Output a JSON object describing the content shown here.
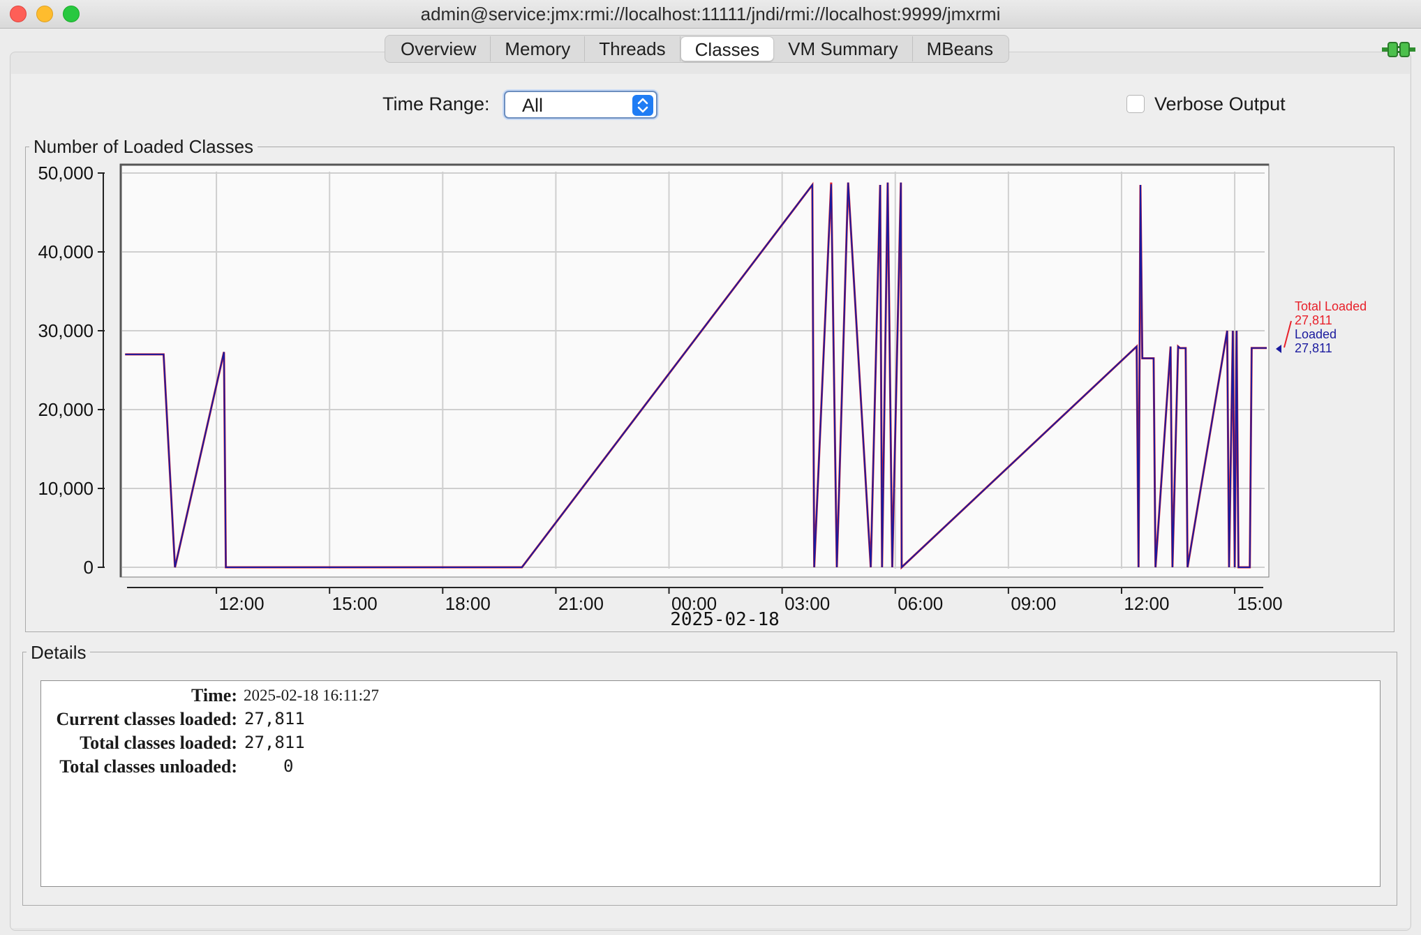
{
  "window": {
    "title": "admin@service:jmx:rmi://localhost:11111/jndi/rmi://localhost:9999/jmxrmi"
  },
  "tabs": [
    {
      "label": "Overview"
    },
    {
      "label": "Memory"
    },
    {
      "label": "Threads"
    },
    {
      "label": "Classes",
      "active": true
    },
    {
      "label": "VM Summary"
    },
    {
      "label": "MBeans"
    }
  ],
  "controls": {
    "time_range_label": "Time Range:",
    "time_range_value": "All",
    "verbose_label": "Verbose Output",
    "verbose_checked": false
  },
  "chart_panel": {
    "title": "Number of Loaded Classes"
  },
  "chart_data": {
    "type": "line",
    "y_ticks": [
      "50,000",
      "40,000",
      "30,000",
      "20,000",
      "10,000",
      "0"
    ],
    "x_ticks": [
      "12:00",
      "15:00",
      "18:00",
      "21:00",
      "00:00",
      "03:00",
      "06:00",
      "09:00",
      "12:00",
      "15:00"
    ],
    "date_label": "2025-02-18",
    "ylim": [
      0,
      50000
    ],
    "grid": true,
    "x_hours_start": 9.5,
    "x_hours_end": 39.85,
    "series": [
      {
        "name": "Total Loaded",
        "current": "27,811",
        "color": "#e8202a",
        "points": [
          [
            9.58,
            27000
          ],
          [
            10.6,
            27000
          ],
          [
            10.9,
            0
          ],
          [
            12.2,
            27300
          ],
          [
            12.25,
            0
          ],
          [
            20.1,
            0
          ],
          [
            27.8,
            48500
          ],
          [
            27.85,
            0
          ],
          [
            28.3,
            48800
          ],
          [
            28.45,
            0
          ],
          [
            28.75,
            48800
          ],
          [
            29.35,
            0
          ],
          [
            29.6,
            48500
          ],
          [
            29.65,
            0
          ],
          [
            29.8,
            48800
          ],
          [
            29.92,
            0
          ],
          [
            30.15,
            48800
          ],
          [
            30.17,
            0
          ],
          [
            36.4,
            28000
          ],
          [
            36.45,
            0
          ],
          [
            36.5,
            48500
          ],
          [
            36.55,
            26500
          ],
          [
            36.85,
            26500
          ],
          [
            36.9,
            0
          ],
          [
            37.3,
            28000
          ],
          [
            37.35,
            0
          ],
          [
            37.5,
            28000
          ],
          [
            37.55,
            27800
          ],
          [
            37.7,
            27800
          ],
          [
            37.75,
            0
          ],
          [
            38.8,
            30000
          ],
          [
            38.85,
            0
          ],
          [
            38.95,
            30000
          ],
          [
            39.0,
            0
          ],
          [
            39.05,
            30000
          ],
          [
            39.1,
            0
          ],
          [
            39.4,
            0
          ],
          [
            39.45,
            27811
          ],
          [
            39.85,
            27811
          ]
        ]
      },
      {
        "name": "Loaded",
        "current": "27,811",
        "color": "#1a1a9e",
        "points": [
          [
            9.58,
            27000
          ],
          [
            10.6,
            27000
          ],
          [
            10.9,
            0
          ],
          [
            12.2,
            27300
          ],
          [
            12.25,
            0
          ],
          [
            20.1,
            0
          ],
          [
            27.8,
            48500
          ],
          [
            27.85,
            0
          ],
          [
            28.3,
            48600
          ],
          [
            28.45,
            0
          ],
          [
            28.75,
            48800
          ],
          [
            29.35,
            0
          ],
          [
            29.6,
            48500
          ],
          [
            29.65,
            0
          ],
          [
            29.8,
            48800
          ],
          [
            29.92,
            0
          ],
          [
            30.15,
            48800
          ],
          [
            30.17,
            0
          ],
          [
            36.4,
            28000
          ],
          [
            36.45,
            0
          ],
          [
            36.5,
            48500
          ],
          [
            36.55,
            26500
          ],
          [
            36.85,
            26500
          ],
          [
            36.9,
            0
          ],
          [
            37.3,
            28000
          ],
          [
            37.35,
            0
          ],
          [
            37.5,
            28000
          ],
          [
            37.55,
            27800
          ],
          [
            37.7,
            27800
          ],
          [
            37.75,
            0
          ],
          [
            38.8,
            30000
          ],
          [
            38.85,
            0
          ],
          [
            38.95,
            30000
          ],
          [
            39.0,
            0
          ],
          [
            39.05,
            30000
          ],
          [
            39.1,
            0
          ],
          [
            39.4,
            0
          ],
          [
            39.45,
            27811
          ],
          [
            39.85,
            27811
          ]
        ]
      }
    ]
  },
  "details": {
    "title": "Details",
    "rows": [
      {
        "label": "Time:",
        "value": "2025-02-18 16:11:27"
      },
      {
        "label": "Current classes loaded:",
        "value": "27,811"
      },
      {
        "label": "Total classes loaded:",
        "value": "27,811"
      },
      {
        "label": "Total classes unloaded:",
        "value": "0"
      }
    ]
  },
  "colors": {
    "accent": "#1f7cf4",
    "total_loaded": "#e8202a",
    "loaded": "#1a1a9e",
    "connection_icon": "#3bb53b"
  }
}
